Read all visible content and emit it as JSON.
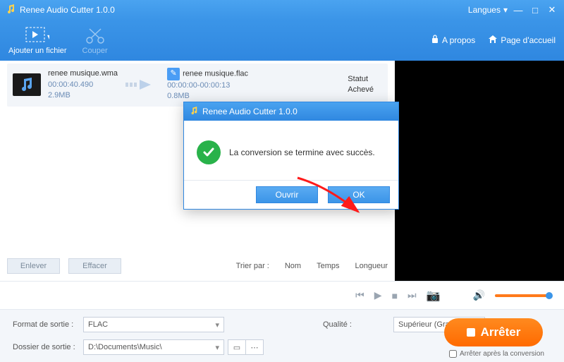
{
  "title": "Renee Audio Cutter 1.0.0",
  "titlebar": {
    "lang": "Langues",
    "minimize": "—",
    "maximize": "□",
    "close": "✕"
  },
  "toolbar": {
    "add": "Ajouter un fichier",
    "cut": "Couper",
    "about": "A propos",
    "home": "Page d'accueil"
  },
  "file": {
    "src_name": "renee musique.wma",
    "src_time": "00:00:40.490",
    "src_size": "2.9MB",
    "dst_name": "renee musique.flac",
    "dst_time": "00:00:00-00:00:13",
    "dst_size": "0.8MB",
    "status_label": "Statut",
    "status_value": "Achevé"
  },
  "listfooter": {
    "remove": "Enlever",
    "clear": "Effacer",
    "sort_by": "Trier par :",
    "sort_name": "Nom",
    "sort_time": "Temps",
    "sort_len": "Longueur"
  },
  "bottom": {
    "format_label": "Format de sortie :",
    "format_value": "FLAC",
    "quality_label": "Qualité :",
    "quality_value": "Supérieur (Grande ta",
    "folder_label": "Dossier de sortie :",
    "folder_value": "D:\\Documents\\Music\\",
    "stop": "Arrêter",
    "stop_after": "Arrêter après la conversion"
  },
  "dialog": {
    "title": "Renee Audio Cutter 1.0.0",
    "message": "La conversion se termine avec succès.",
    "open": "Ouvrir",
    "ok": "OK"
  }
}
